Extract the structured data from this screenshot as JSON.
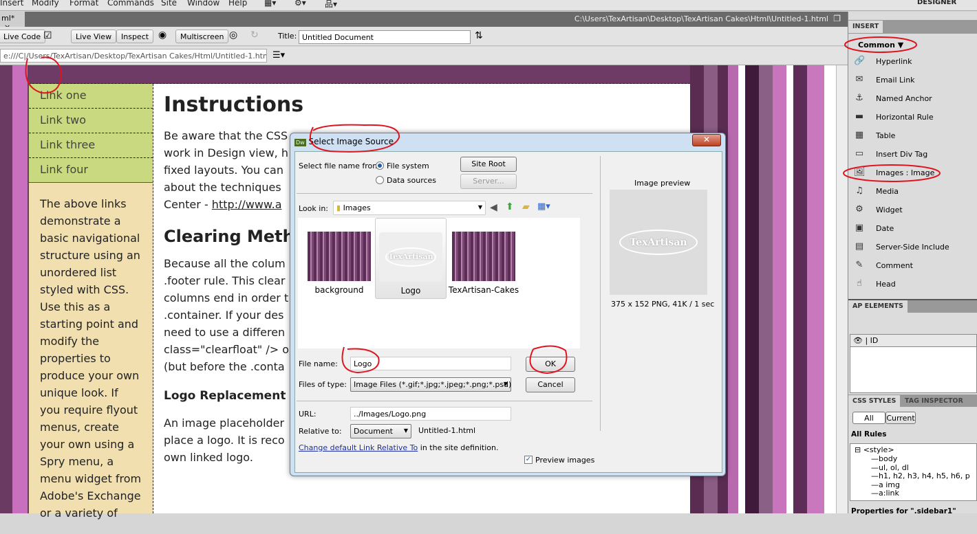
{
  "menu": [
    "Insert",
    "Modify",
    "Format",
    "Commands",
    "Site",
    "Window",
    "Help"
  ],
  "workspace": "DESIGNER",
  "doc_tab": "ml*",
  "doc_path": "C:\\Users\\TexArtisan\\Desktop\\TexArtisan Cakes\\Html\\Untitled-1.html",
  "toolbar": {
    "live_code": "Live Code",
    "live_view": "Live View",
    "inspect": "Inspect",
    "multiscreen": "Multiscreen",
    "title_label": "Title:",
    "title_value": "Untitled Document"
  },
  "address": "e:///C|/Users/TexArtisan/Desktop/TexArtisan Cakes/Html/Untitled-1.html",
  "page": {
    "nav": [
      "Link one",
      "Link two",
      "Link three",
      "Link four"
    ],
    "sidebar_text": "The above links demonstrate a basic navigational structure using an unordered list styled with CSS. Use this as a starting point and modify the properties to produce your own unique look. If you require flyout menus, create your own using a Spry menu, a menu widget from Adobe's Exchange or a variety of",
    "h1": "Instructions",
    "p1_lines": [
      "Be aware that the CSS",
      "work in Design view, h",
      "fixed layouts. You can",
      "about the techniques"
    ],
    "p1_center": "Center - ",
    "p1_link": "http://www.a",
    "h2": "Clearing Meth",
    "p2_lines": [
      "Because all the colum",
      ".footer rule. This clear",
      "columns end in order t",
      ".container. If your des",
      "need to use a differen",
      "class=\"clearfloat\" /> o",
      "(but before the .conta"
    ],
    "h3": "Logo Replacement",
    "p3_lines": [
      "An image placeholder",
      "place a logo. It is reco",
      "own linked logo."
    ]
  },
  "insert_panel": {
    "tab": "INSERT",
    "category": "Common",
    "items": [
      {
        "label": "Hyperlink",
        "icon": "hyperlink-icon"
      },
      {
        "label": "Email Link",
        "icon": "email-icon"
      },
      {
        "label": "Named Anchor",
        "icon": "anchor-icon"
      },
      {
        "label": "Horizontal Rule",
        "icon": "hr-icon"
      },
      {
        "label": "Table",
        "icon": "table-icon"
      },
      {
        "label": "Insert Div Tag",
        "icon": "div-icon"
      },
      {
        "label": "Images : Image",
        "icon": "image-icon"
      },
      {
        "label": "Media",
        "icon": "media-icon"
      },
      {
        "label": "Widget",
        "icon": "widget-icon"
      },
      {
        "label": "Date",
        "icon": "date-icon"
      },
      {
        "label": "Server-Side Include",
        "icon": "ssi-icon"
      },
      {
        "label": "Comment",
        "icon": "comment-icon"
      },
      {
        "label": "Head",
        "icon": "head-icon"
      }
    ]
  },
  "ap_panel": {
    "tab": "AP ELEMENTS",
    "col_id": "ID"
  },
  "css_panel": {
    "tab1": "CSS STYLES",
    "tab2": "TAG INSPECTOR",
    "all": "All",
    "current": "Current",
    "all_rules": "All Rules",
    "root": "<style>",
    "rules": [
      "body",
      "ul, ol, dl",
      "h1, h2, h3, h4, h5, h6, p",
      "a img",
      "a:link"
    ],
    "props": "Properties for \".sidebar1\""
  },
  "dialog": {
    "title": "Select Image Source",
    "select_from": "Select file name from:",
    "file_system": "File system",
    "data_sources": "Data sources",
    "site_root": "Site Root",
    "server": "Server...",
    "look_in": "Look in:",
    "folder": "Images",
    "files": [
      "background",
      "Logo",
      "TexArtisan-Cakes"
    ],
    "selected_file": "Logo",
    "file_name_label": "File name:",
    "file_name": "Logo",
    "files_type_label": "Files of type:",
    "files_type": "Image Files (*.gif;*.jpg;*.jpeg;*.png;*.psd)",
    "ok": "OK",
    "cancel": "Cancel",
    "url_label": "URL:",
    "url": "../Images/Logo.png",
    "relative_label": "Relative to:",
    "relative": "Document",
    "relative_file": "Untitled-1.html",
    "change_link": "Change default Link Relative To",
    "change_rest": " in the site definition.",
    "preview_label": "Preview images",
    "preview_checked": true,
    "preview_title": "Image preview",
    "preview_info": "375 x 152 PNG, 41K / 1 sec",
    "logo_text": "TexArtisan"
  },
  "colors": {
    "purple": "#6e3a66",
    "nav_green": "#c9d97f",
    "sidebar_tan": "#f1dfb0",
    "annotation_red": "#e0141e"
  }
}
